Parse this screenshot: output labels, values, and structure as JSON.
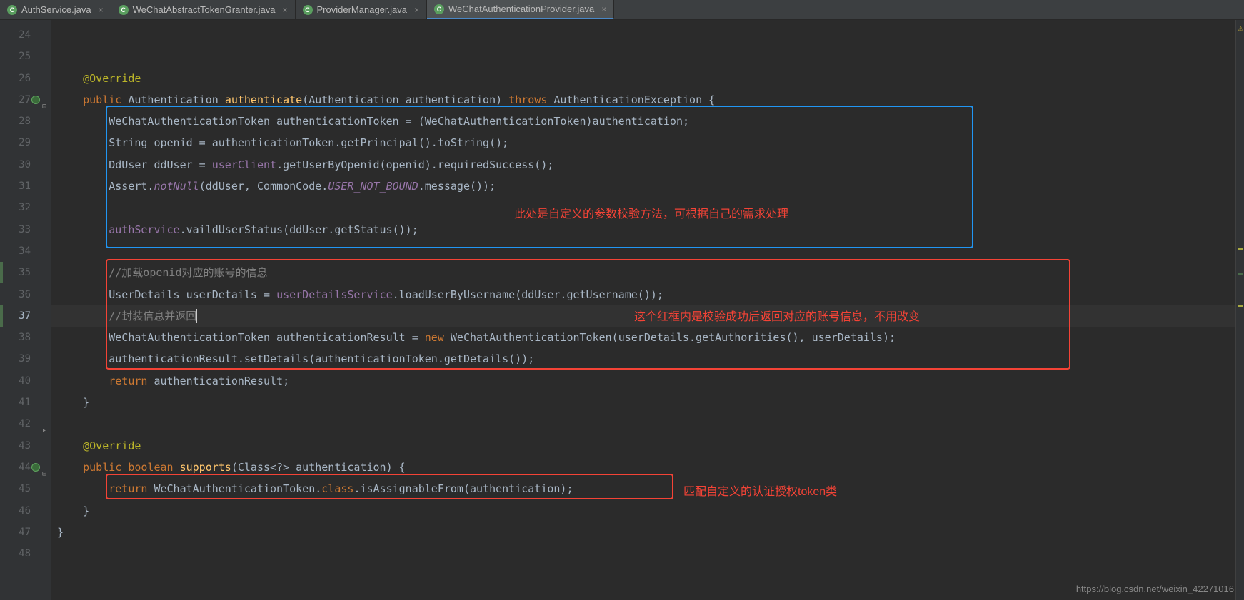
{
  "tabs": [
    {
      "label": "AuthService.java",
      "icon": "C",
      "active": false
    },
    {
      "label": "WeChatAbstractTokenGranter.java",
      "icon": "C",
      "active": false
    },
    {
      "label": "ProviderManager.java",
      "icon": "C",
      "active": false
    },
    {
      "label": "WeChatAuthenticationProvider.java",
      "icon": "C",
      "active": true
    }
  ],
  "lines": {
    "start": 24,
    "end": 48,
    "current": 37
  },
  "code": {
    "l26_ann": "@Override",
    "l27_kw1": "public",
    "l27_type1": "Authentication",
    "l27_meth": "authenticate",
    "l27_type2": "Authentication",
    "l27_param": "authentication",
    "l27_kw2": "throws",
    "l27_type3": "AuthenticationException",
    "l28": "WeChatAuthenticationToken authenticationToken = (WeChatAuthenticationToken)authentication;",
    "l29": "String openid = authenticationToken.getPrincipal().toString();",
    "l30_p1": "DdUser ddUser = ",
    "l30_field": "userClient",
    "l30_p2": ".getUserByOpenid(openid).requiredSuccess();",
    "l31_p1": "Assert.",
    "l31_static": "notNull",
    "l31_p2": "(ddUser, CommonCode.",
    "l31_enum": "USER_NOT_BOUND",
    "l31_p3": ".message());",
    "l33_field": "authService",
    "l33_p2": ".vaildUserStatus(ddUser.getStatus());",
    "l35_cmt": "//加载openid对应的账号的信息",
    "l36_p1": "UserDetails userDetails = ",
    "l36_field": "userDetailsService",
    "l36_p2": ".loadUserByUsername(ddUser.getUsername());",
    "l37_cmt": "//封装信息并返回",
    "l38_p1": "WeChatAuthenticationToken authenticationResult = ",
    "l38_kw": "new",
    "l38_p2": " WeChatAuthenticationToken(userDetails.getAuthorities(), userDetails);",
    "l39": "authenticationResult.setDetails(authenticationToken.getDetails());",
    "l40_kw": "return",
    "l40_p2": " authenticationResult;",
    "l43_ann": "@Override",
    "l44_kw1": "public",
    "l44_kw2": "boolean",
    "l44_meth": "supports",
    "l44_p2": "(Class<?> authentication) {",
    "l45_kw": "return",
    "l45_p1": " WeChatAuthenticationToken.",
    "l45_kw2": "class",
    "l45_p2": ".isAssignableFrom(authentication);"
  },
  "annotations": {
    "text1": "此处是自定义的参数校验方法，可根据自己的需求处理",
    "text2": "这个红框内是校验成功后返回对应的账号信息，不用改变",
    "text3": "匹配自定义的认证授权token类"
  },
  "watermark": "https://blog.csdn.net/weixin_42271016"
}
